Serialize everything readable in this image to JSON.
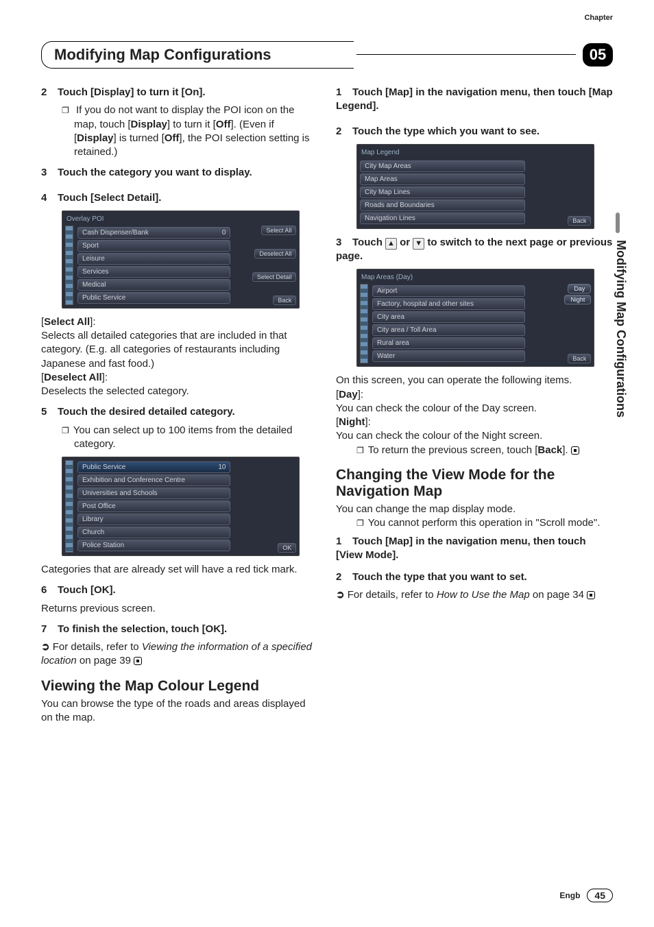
{
  "header": {
    "chapter_label": "Chapter",
    "title": "Modifying Map Configurations",
    "chapter_number": "05"
  },
  "side_label": "Modifying Map Configurations",
  "left": {
    "s2": {
      "num": "2",
      "text": "Touch [Display] to turn it [On]."
    },
    "s2_bullet": "If you do not want to display the POI icon on the map, touch [",
    "s2_b1": "Display",
    "s2_b1b": "] to turn it [",
    "s2_b2": "Off",
    "s2_b1c": "]. (Even if [",
    "s2_b3": "Display",
    "s2_b1d": "] is turned [",
    "s2_b4": "Off",
    "s2_b1e": "], the POI selection setting is retained.)",
    "s3": {
      "num": "3",
      "text": "Touch the category you want to display."
    },
    "s4": {
      "num": "4",
      "text": "Touch [Select Detail]."
    },
    "fig1": {
      "title": "Overlay POI",
      "rows": [
        "Cash Dispenser/Bank",
        "Sport",
        "Leisure",
        "Services",
        "Medical",
        "Public Service"
      ],
      "count": "0",
      "btns": [
        "Select All",
        "Deselect All",
        "Select Detail",
        "Back"
      ]
    },
    "selall_label": "Select All",
    "selall_body": "Selects all detailed categories that are included in that category. (E.g. all categories of restaurants including Japanese and fast food.)",
    "desall_label": "Deselect All",
    "desall_body": "Deselects the selected category.",
    "s5": {
      "num": "5",
      "text": "Touch the desired detailed category."
    },
    "s5_bullet": "You can select up to 100 items from the detailed category.",
    "fig2": {
      "title": "Public Service",
      "count": "10",
      "rows": [
        "Exhibition and Conference Centre",
        "Universities and Schools",
        "Post Office",
        "Library",
        "Church",
        "Police Station"
      ],
      "ok": "OK"
    },
    "after_fig2": "Categories that are already set will have a red tick mark.",
    "s6": {
      "num": "6",
      "text": "Touch [OK]."
    },
    "s6_body": "Returns previous screen.",
    "s7": {
      "num": "7",
      "text": "To finish the selection, touch [OK]."
    },
    "s7_arrow": "For details, refer to ",
    "s7_italic": "Viewing the information of a specified location",
    "s7_tail": " on page 39",
    "section1": "Viewing the Map Colour Legend",
    "section1_body": "You can browse the type of the roads and areas displayed on the map."
  },
  "right": {
    "r1": {
      "num": "1",
      "text": "Touch [Map] in the navigation menu, then touch [Map Legend]."
    },
    "r2": {
      "num": "2",
      "text": "Touch the type which you want to see."
    },
    "fig3": {
      "title": "Map Legend",
      "rows": [
        "City Map Areas",
        "Map Areas",
        "City Map Lines",
        "Roads and Boundaries",
        "Navigation Lines"
      ],
      "back": "Back"
    },
    "r3a": {
      "num": "3",
      "pre": "Touch ",
      "post": " to switch to the next page or previous page."
    },
    "fig4": {
      "title": "Map Areas (Day)",
      "rows": [
        "Airport",
        "Factory, hospital and other sites",
        "City area",
        "City area / Toll Area",
        "Rural area",
        "Water"
      ],
      "day": "Day",
      "night": "Night",
      "back": "Back"
    },
    "after_fig4": "On this screen, you can operate the following items.",
    "day_label": "Day",
    "day_body": "You can check the colour of the Day screen.",
    "night_label": "Night",
    "night_body": "You can check the colour of the Night screen.",
    "return_bullet": "To return the previous screen, touch [",
    "return_b": "Back",
    "return_tail": "].",
    "section2": "Changing the View Mode for the Navigation Map",
    "section2_body": "You can change the map display mode.",
    "section2_bullet": "You cannot perform this operation in \"Scroll mode\".",
    "rr1": {
      "num": "1",
      "text": "Touch [Map] in the navigation menu, then touch [View Mode]."
    },
    "rr2": {
      "num": "2",
      "text": "Touch the type that you want to set."
    },
    "rr2_arrow": "For details, refer to ",
    "rr2_italic": "How to Use the Map",
    "rr2_tail": " on page 34"
  },
  "footer": {
    "lang": "Engb",
    "page": "45"
  }
}
